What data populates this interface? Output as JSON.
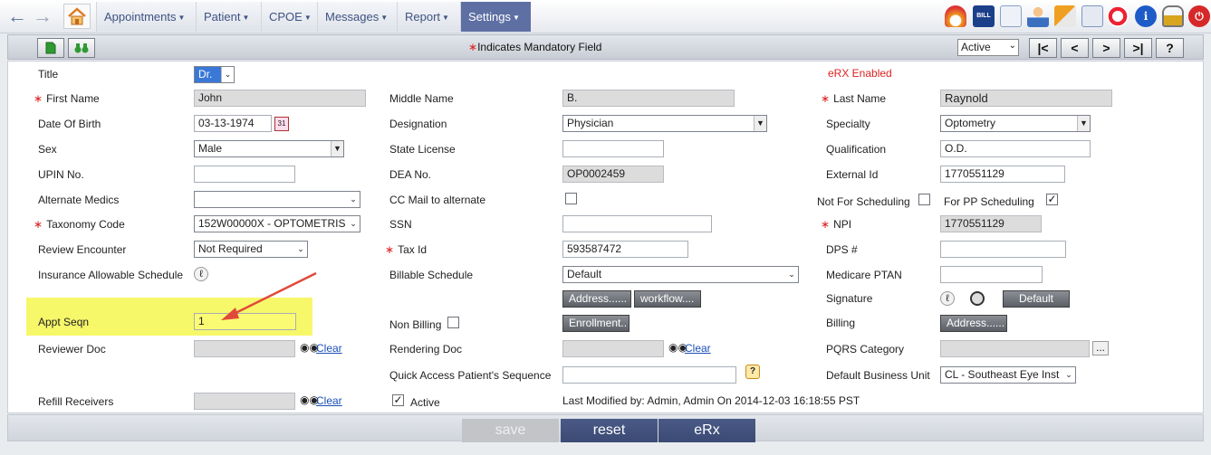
{
  "nav": {
    "menus": [
      "Appointments",
      "Patient",
      "CPOE",
      "Messages",
      "Report",
      "Settings"
    ]
  },
  "toolbar": {
    "mandatory_text": "Indicates Mandatory Field",
    "status_value": "Active",
    "nav_buttons": [
      "|<",
      "<",
      ">",
      ">|",
      "?"
    ]
  },
  "form": {
    "erx_enabled": "eRX Enabled",
    "title": {
      "label": "Title",
      "value": "Dr."
    },
    "first_name": {
      "label": "First Name",
      "value": "John"
    },
    "middle_name": {
      "label": "Middle Name",
      "value": "B."
    },
    "last_name": {
      "label": "Last Name",
      "value": "Raynold"
    },
    "dob": {
      "label": "Date Of Birth",
      "value": "03-13-1974"
    },
    "designation": {
      "label": "Designation",
      "value": "Physician"
    },
    "specialty": {
      "label": "Specialty",
      "value": "Optometry"
    },
    "sex": {
      "label": "Sex",
      "value": "Male"
    },
    "state_license": {
      "label": "State License",
      "value": ""
    },
    "qualification": {
      "label": "Qualification",
      "value": "O.D."
    },
    "upin": {
      "label": "UPIN No.",
      "value": ""
    },
    "dea": {
      "label": "DEA No.",
      "value": "OP0002459"
    },
    "external_id": {
      "label": "External Id",
      "value": "1770551129"
    },
    "alternate_medics": {
      "label": "Alternate Medics",
      "value": ""
    },
    "cc_mail": {
      "label": "CC Mail to alternate"
    },
    "not_for_scheduling": {
      "label": "Not For Scheduling"
    },
    "for_pp_scheduling": {
      "label": "For PP Scheduling"
    },
    "taxonomy": {
      "label": "Taxonomy Code",
      "value": "152W00000X - OPTOMETRIS"
    },
    "ssn": {
      "label": "SSN",
      "value": ""
    },
    "npi": {
      "label": "NPI",
      "value": "1770551129"
    },
    "review_encounter": {
      "label": "Review Encounter",
      "value": "Not Required"
    },
    "tax_id": {
      "label": "Tax Id",
      "value": "593587472"
    },
    "dps": {
      "label": "DPS #",
      "value": ""
    },
    "insurance_schedule": {
      "label": "Insurance Allowable Schedule"
    },
    "billable_schedule": {
      "label": "Billable Schedule",
      "value": "Default"
    },
    "medicare_ptan": {
      "label": "Medicare PTAN",
      "value": ""
    },
    "address_btn": "Address......",
    "workflow_btn": "workflow....",
    "signature": {
      "label": "Signature",
      "button": "Default"
    },
    "appt_seqn": {
      "label": "Appt Seqn",
      "value": "1"
    },
    "non_billing": {
      "label": "Non Billing"
    },
    "enrollment_btn": "Enrollment..",
    "billing": {
      "label": "Billing",
      "button": "Address......"
    },
    "reviewer_doc": {
      "label": "Reviewer Doc",
      "clear": "Clear"
    },
    "rendering_doc": {
      "label": "Rendering Doc",
      "clear": "Clear"
    },
    "pqrs": {
      "label": "PQRS Category",
      "button": "..."
    },
    "quick_access": {
      "label": "Quick Access Patient's Sequence",
      "value": ""
    },
    "default_bu": {
      "label": "Default Business Unit",
      "value": "CL - Southeast Eye Inst"
    },
    "refill": {
      "label": "Refill Receivers",
      "clear": "Clear"
    },
    "active": {
      "label": "Active"
    },
    "last_modified": "Last Modified by: Admin, Admin On 2014-12-03 16:18:55 PST"
  },
  "actions": {
    "save": "save",
    "reset": "reset",
    "erx": "eRx"
  },
  "colors": {
    "accent": "#5e6fa3",
    "required": "#dd2222",
    "highlight": "#f7f76a",
    "link": "#1a4fb8"
  }
}
